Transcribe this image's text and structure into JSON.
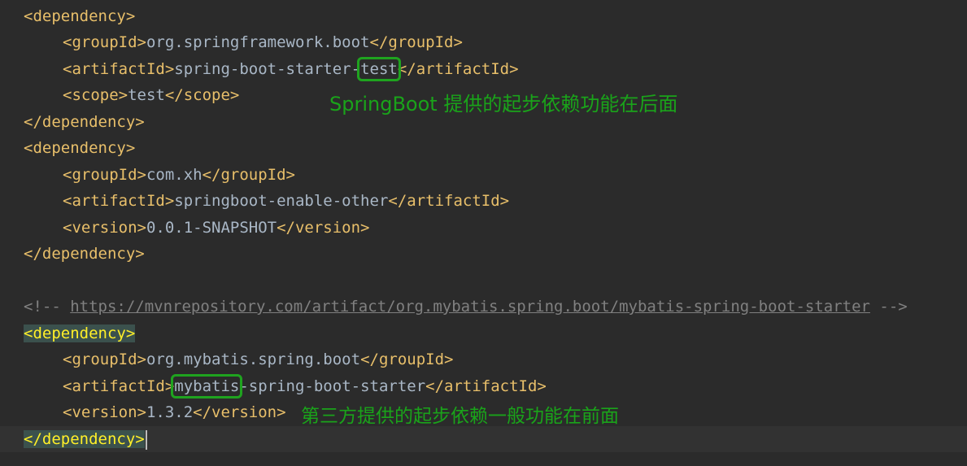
{
  "lines": [
    {
      "a": "<dependency>"
    },
    {
      "a": "<groupId>",
      "b": "org.springframework.boot",
      "c": "</groupId>"
    },
    {
      "a": "<artifactId>",
      "b": "spring-boot-starter-",
      "c": "test",
      "d": "</artifactId>"
    },
    {
      "a": "<scope>",
      "b": "test",
      "c": "</scope>"
    },
    {
      "a": "</dependency>"
    },
    {
      "a": "<dependency>"
    },
    {
      "a": "<groupId>",
      "b": "com.xh",
      "c": "</groupId>"
    },
    {
      "a": "<artifactId>",
      "b": "springboot-enable-other",
      "c": "</artifactId>"
    },
    {
      "a": "<version>",
      "b": "0.0.1-SNAPSHOT",
      "c": "</version>"
    },
    {
      "a": "</dependency>"
    },
    {},
    {
      "a": "<!-- ",
      "b": "https://mvnrepository.com/artifact/org.mybatis.spring.boot/mybatis-spring-boot-starter",
      "c": " -->"
    },
    {
      "a": "<dependency>"
    },
    {
      "a": "<groupId>",
      "b": "org.mybatis.spring.boot",
      "c": "</groupId>"
    },
    {
      "a": "<artifactId>",
      "b": "mybatis",
      "c": "-spring-boot-starter",
      "d": "</artifactId>"
    },
    {
      "a": "<version>",
      "b": "1.3.2",
      "c": "</version>"
    },
    {
      "a": "</dependency>",
      "b": ">"
    }
  ],
  "annotations": {
    "note1": "SpringBoot 提供的起步依赖功能在后面",
    "note2": "第三方提供的起步依赖一般功能在前面"
  },
  "colors": {
    "background": "#2b2b2b",
    "tag": "#e8bf6a",
    "text": "#a9b7c6",
    "comment": "#808080",
    "annotation": "#1aa31a",
    "highlight_box": "#1fa31f"
  }
}
